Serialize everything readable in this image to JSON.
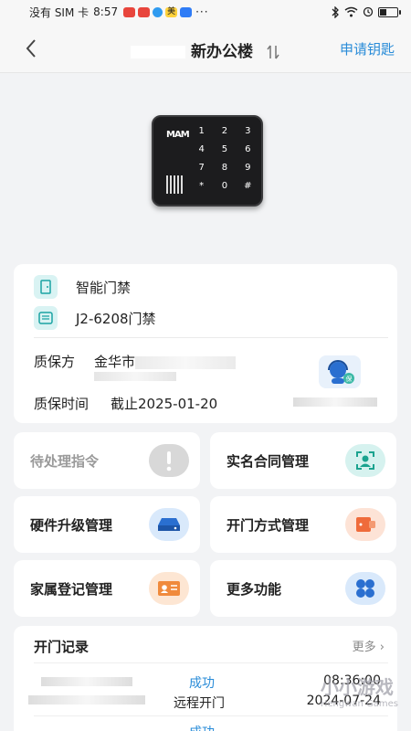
{
  "status_bar": {
    "carrier": "没有 SIM 卡",
    "time": "8:57",
    "more": "···",
    "battery_level": 0.4,
    "app_colors": [
      "#e8453c",
      "#e8453c",
      "#2f9bf0",
      "#ffd23c",
      "#2f7cf6"
    ],
    "app_meituan": "美"
  },
  "nav": {
    "title": "新办公楼",
    "action": "申请钥匙"
  },
  "device": {
    "logo": "MAM",
    "keys": [
      "1",
      "2",
      "3",
      "4",
      "5",
      "6",
      "7",
      "8",
      "9",
      "*",
      "0",
      "#"
    ]
  },
  "info": {
    "type_label": "智能门禁",
    "device_name": "J2-6208门禁",
    "warranty_label": "质保方",
    "warranty_value": "金华市",
    "warranty_time_label": "质保时间",
    "warranty_time_value": "截止2025-01-20"
  },
  "tiles": {
    "pending": "待处理指令",
    "contract": "实名合同管理",
    "firmware": "硬件升级管理",
    "unlock": "开门方式管理",
    "family": "家属登记管理",
    "more": "更多功能"
  },
  "records": {
    "title": "开门记录",
    "more": "更多",
    "rows": [
      {
        "status": "成功",
        "method": "远程开门",
        "time": "08:36:00",
        "date": "2024-07-24"
      }
    ],
    "next_status": "成功"
  },
  "watermark": {
    "main": "小小游戏",
    "sub": "Hengwan Games"
  },
  "colors": {
    "accent": "#2a8cd8",
    "tile_teal": "#d6f2ef",
    "tile_blue": "#d9e9fb",
    "tile_orange": "#fde3d6",
    "tile_gray": "#d8d8d8"
  }
}
